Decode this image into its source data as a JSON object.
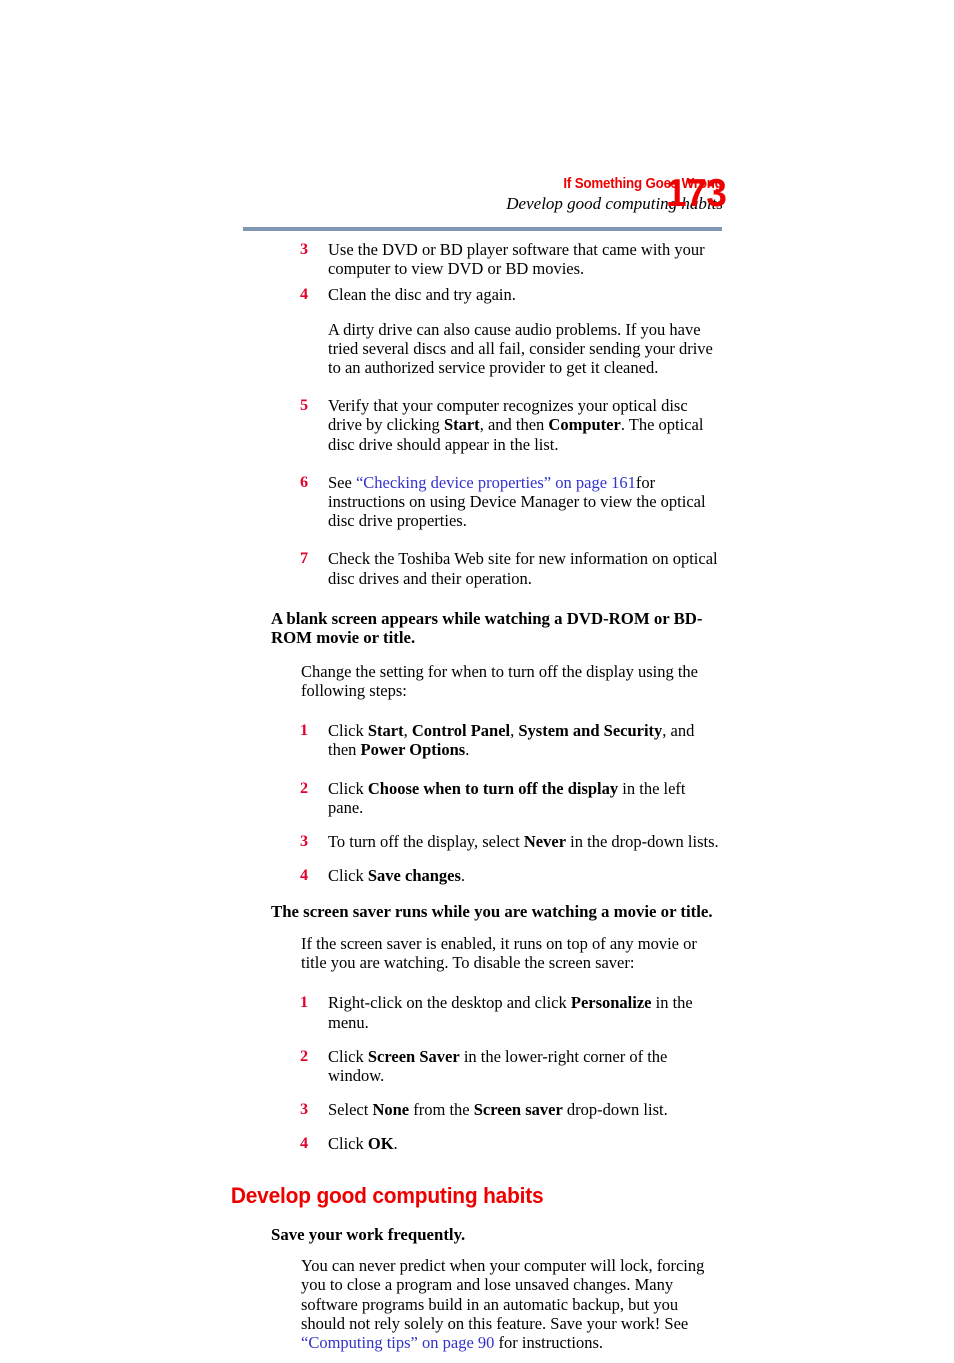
{
  "document": {
    "page_number": "173",
    "header": {
      "chapter_title": "If Something Goes Wrong",
      "section_title": "Develop good computing habits"
    },
    "colors": {
      "heading_red": "#EE0000",
      "list_number_red": "#E3002B",
      "link_blue": "#3333CC",
      "rule_blue_gray": "#8097B4",
      "body_black": "#000000"
    }
  },
  "content": {
    "optical_drive_steps": [
      {
        "number": "3",
        "text": "Use the DVD or BD player software that came with your computer to view DVD or BD movies."
      },
      {
        "number": "4",
        "text": "Clean the disc and try again."
      }
    ],
    "dirty_drive_paragraph": "A dirty drive can also cause audio problems. If you have tried several discs and all fail, consider sending your drive to an authorized service provider to get it cleaned.",
    "step5": {
      "number": "5",
      "part1": "Verify that your computer recognizes your optical disc drive by clicking ",
      "bold1": "Start",
      "part2": ", and then ",
      "bold2": "Computer",
      "part3": ". The optical disc drive should appear in the list."
    },
    "step6": {
      "number": "6",
      "part1": "See ",
      "link": "“Checking device properties” on page 161",
      "part2": "for instructions on using Device Manager to view the optical disc drive properties."
    },
    "step7": {
      "number": "7",
      "text": "Check the Toshiba Web site for new information on optical disc drives and their operation."
    },
    "blank_screen": {
      "heading": "A blank screen appears while watching a DVD-ROM or BD-ROM movie or title.",
      "intro": "Change the setting for when to turn off the display using the following steps:",
      "steps": [
        {
          "number": "1",
          "part1": "Click ",
          "bold1": "Start",
          "part2": ", ",
          "bold2": "Control Panel",
          "part3": ", ",
          "bold3": "System and Security",
          "part4": ", and then ",
          "bold4": "Power Options",
          "part5": "."
        },
        {
          "number": "2",
          "part1": "Click ",
          "bold1": "Choose when to turn off the display",
          "part2": " in the left pane."
        },
        {
          "number": "3",
          "part1": "To turn off the display, select ",
          "bold1": "Never",
          "part2": " in the drop-down lists."
        },
        {
          "number": "4",
          "part1": "Click ",
          "bold1": "Save changes",
          "part2": "."
        }
      ]
    },
    "screen_saver": {
      "heading": "The screen saver runs while you are watching a movie or title.",
      "intro": "If the screen saver is enabled, it runs on top of any movie or title you are watching. To disable the screen saver:",
      "steps": [
        {
          "number": "1",
          "part1": "Right-click on the desktop and click ",
          "bold1": "Personalize",
          "part2": " in the menu."
        },
        {
          "number": "2",
          "part1": "Click ",
          "bold1": "Screen Saver",
          "part2": " in the lower-right corner of the window."
        },
        {
          "number": "3",
          "part1": "Select ",
          "bold1": "None",
          "part2": " from the ",
          "bold2": "Screen saver",
          "part3": " drop-down list."
        },
        {
          "number": "4",
          "part1": "Click ",
          "bold1": "OK",
          "part2": "."
        }
      ]
    },
    "develop_habits": {
      "section_heading": "Develop good computing habits",
      "subheading": "Save your work frequently.",
      "paragraph_part1": "You can never predict when your computer will lock, forcing you to close a program and lose unsaved changes. Many software programs build in an automatic backup, but you should not rely solely on this feature. Save your work! See ",
      "link": "“Computing tips” on page 90",
      "paragraph_part2": " for instructions."
    }
  }
}
